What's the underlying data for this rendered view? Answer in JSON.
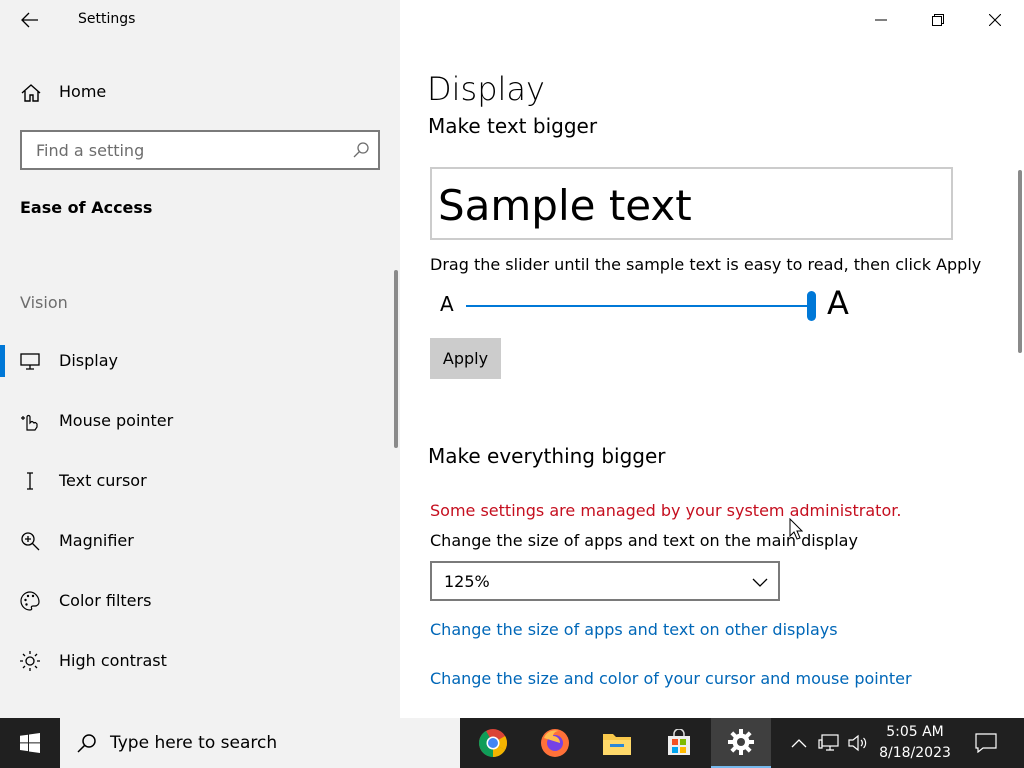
{
  "app": {
    "title": "Settings"
  },
  "sidebar": {
    "home_label": "Home",
    "search_placeholder": "Find a setting",
    "section_title": "Ease of Access",
    "group_label": "Vision",
    "items": [
      {
        "label": "Display",
        "icon": "monitor-icon",
        "active": true
      },
      {
        "label": "Mouse pointer",
        "icon": "pointer-icon",
        "active": false
      },
      {
        "label": "Text cursor",
        "icon": "text-cursor-icon",
        "active": false
      },
      {
        "label": "Magnifier",
        "icon": "magnifier-icon",
        "active": false
      },
      {
        "label": "Color filters",
        "icon": "palette-icon",
        "active": false
      },
      {
        "label": "High contrast",
        "icon": "sun-icon",
        "active": false
      }
    ]
  },
  "main": {
    "page_title": "Display",
    "text_section": {
      "title": "Make text bigger",
      "sample_text": "Sample text",
      "slider_description": "Drag the slider until the sample text is easy to read, then click Apply",
      "slider_small_label": "A",
      "slider_large_label": "A",
      "slider_value_fraction": 1.0,
      "apply_label": "Apply"
    },
    "everything_section": {
      "title": "Make everything bigger",
      "admin_note": "Some settings are managed by your system administrator.",
      "size_description": "Change the size of apps and text on the main display",
      "selected_scale": "125%",
      "link_other_displays": "Change the size of apps and text on other displays",
      "link_cursor": "Change the size and color of your cursor and mouse pointer"
    }
  },
  "taskbar": {
    "search_placeholder": "Type here to search",
    "apps": [
      "chrome-icon",
      "firefox-icon",
      "file-explorer-icon",
      "store-icon",
      "settings-icon"
    ],
    "time": "5:05 AM",
    "date": "8/18/2023"
  },
  "colors": {
    "accent": "#0078d7",
    "link": "#0067b8",
    "warning": "#c50f1f",
    "taskbar": "#202020"
  }
}
